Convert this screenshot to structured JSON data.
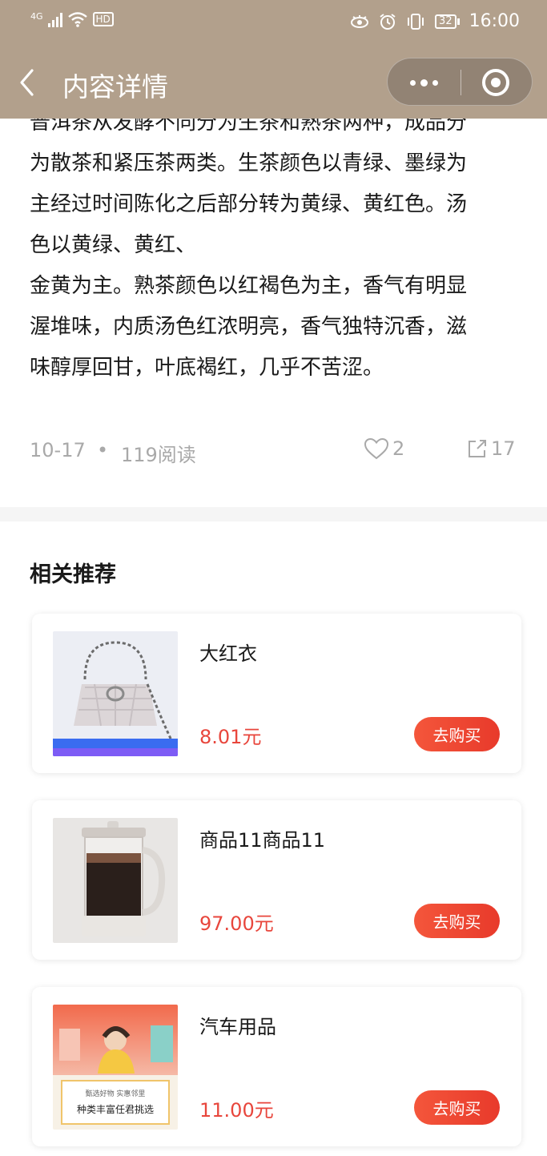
{
  "status_bar": {
    "network": "4G",
    "hd": "HD",
    "battery": "32",
    "time": "16:00"
  },
  "nav": {
    "title": "内容详情"
  },
  "article": {
    "lines": [
      "普洱茶从发酵不同分为生茶和熟茶两种，成品分",
      "为散茶和紧压茶两类。生茶颜色以青绿、墨绿为",
      "主经过时间陈化之后部分转为黄绿、黄红色。汤",
      "色以黄绿、黄红、",
      "金黄为主。熟茶颜色以红褐色为主，香气有明显",
      "渥堆味，内质汤色红浓明亮，香气独特沉香，滋",
      "味醇厚回甘，叶底褐红，几乎不苦涩。"
    ]
  },
  "meta": {
    "date": "10-17",
    "separator": "•",
    "reads": "119阅读",
    "likes": "2",
    "shares": "17"
  },
  "related": {
    "title": "相关推荐",
    "buy_label": "去购买",
    "items": [
      {
        "name": "大红衣",
        "price": "8.01元",
        "image": "handbag"
      },
      {
        "name": "商品11商品11",
        "price": "97.00元",
        "image": "french-press"
      },
      {
        "name": "汽车用品",
        "price": "11.00元",
        "image": "promo-poster",
        "poster_sub": "甄选好物 实惠邻里",
        "poster_main": "种类丰富任君挑选"
      }
    ]
  },
  "colors": {
    "header_bg": "#b2a08c",
    "price": "#e8463c",
    "buy_button": "#e83a2b",
    "meta_text": "#a9a9a9"
  }
}
